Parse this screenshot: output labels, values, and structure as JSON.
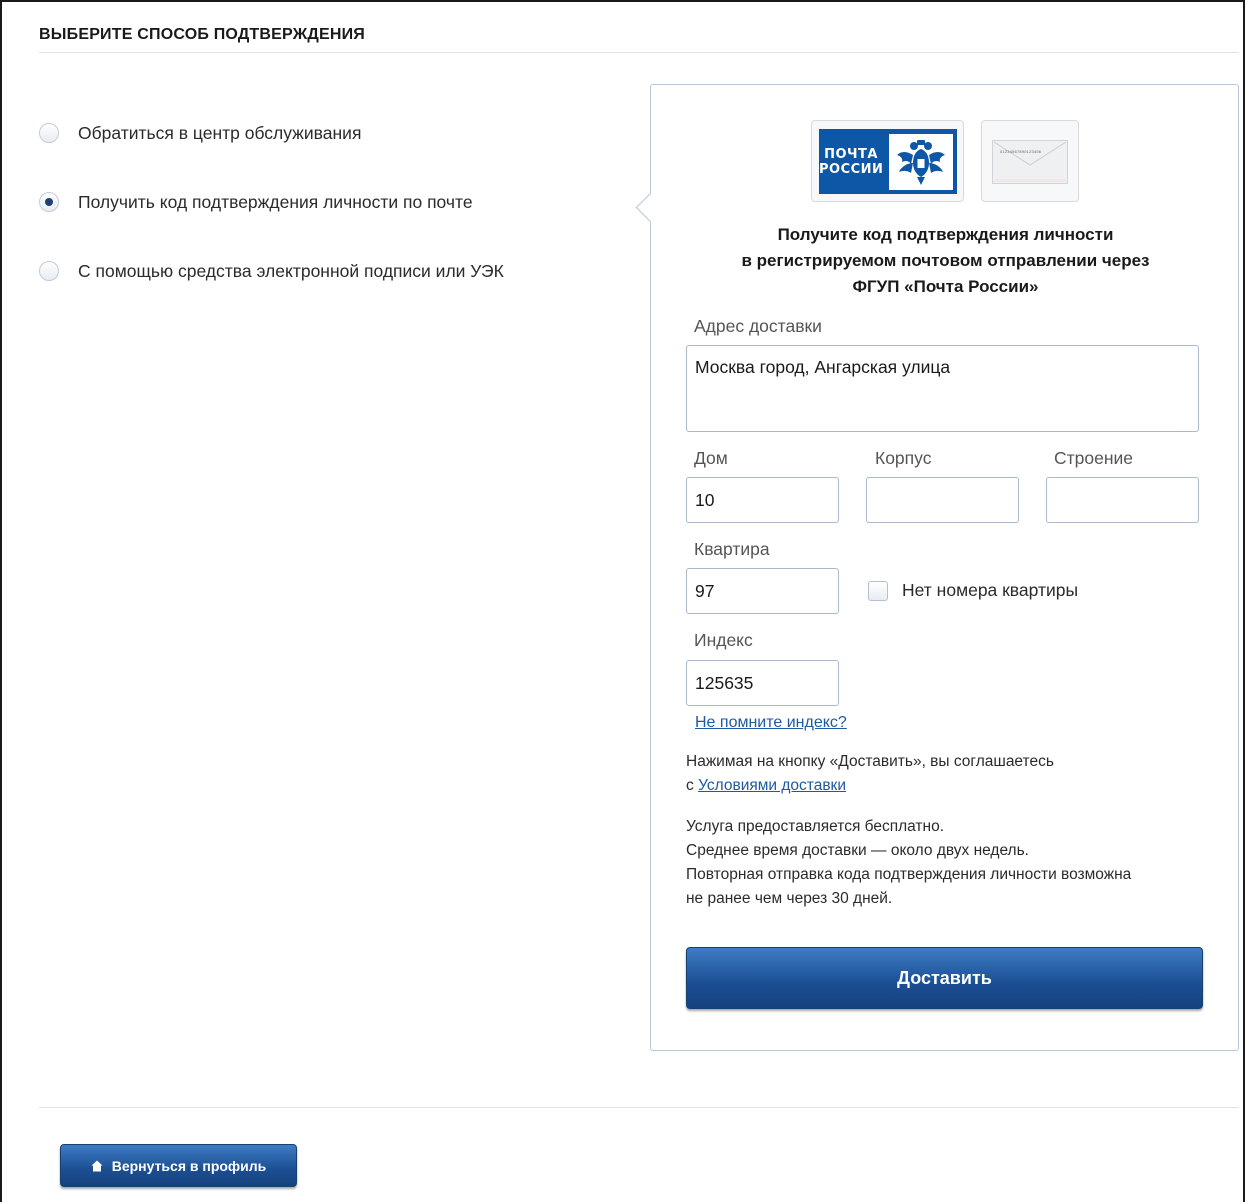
{
  "section": {
    "title": "ВЫБЕРИТЕ СПОСОБ ПОДТВЕРЖДЕНИЯ"
  },
  "options": [
    {
      "label": "Обратиться в центр обслуживания",
      "selected": false
    },
    {
      "label": "Получить код подтверждения личности по почте",
      "selected": true
    },
    {
      "label": "С помощью средства электронной подписи или УЭК",
      "selected": false
    }
  ],
  "panel": {
    "logo_text_line1": "ПОЧТА",
    "logo_text_line2": "РОССИИ",
    "envelope_code": "01234567890123456",
    "heading_line1": "Получите код подтверждения личности",
    "heading_line2": "в регистрируемом почтовом отправлении через",
    "heading_line3": "ФГУП «Почта России»",
    "address_label": "Адрес доставки",
    "address_value": "Москва город, Ангарская улица",
    "house_label": "Дом",
    "house_value": "10",
    "building_label": "Корпус",
    "building_value": "",
    "structure_label": "Строение",
    "structure_value": "",
    "apartment_label": "Квартира",
    "apartment_value": "97",
    "no_apartment_label": "Нет номера квартиры",
    "no_apartment_checked": false,
    "index_label": "Индекс",
    "index_value": "125635",
    "forgot_index_link": "Не помните индекс?",
    "agreement_text": "Нажимая на кнопку «Доставить», вы соглашаетесь",
    "agreement_prefix": "с",
    "agreement_link": "Условиями доставки",
    "info_line1": "Услуга предоставляется бесплатно.",
    "info_line2": "Среднее время доставки — около двух недель.",
    "info_line3": "Повторная отправка кода подтверждения личности возможна",
    "info_line4": "не ранее чем через 30 дней.",
    "submit_label": "Доставить"
  },
  "footer": {
    "back_label": "Вернуться в профиль"
  },
  "colors": {
    "accent": "#1b4e93",
    "link": "#1f5aa0",
    "border": "#b9c7d8",
    "post_blue": "#0d57a6"
  }
}
